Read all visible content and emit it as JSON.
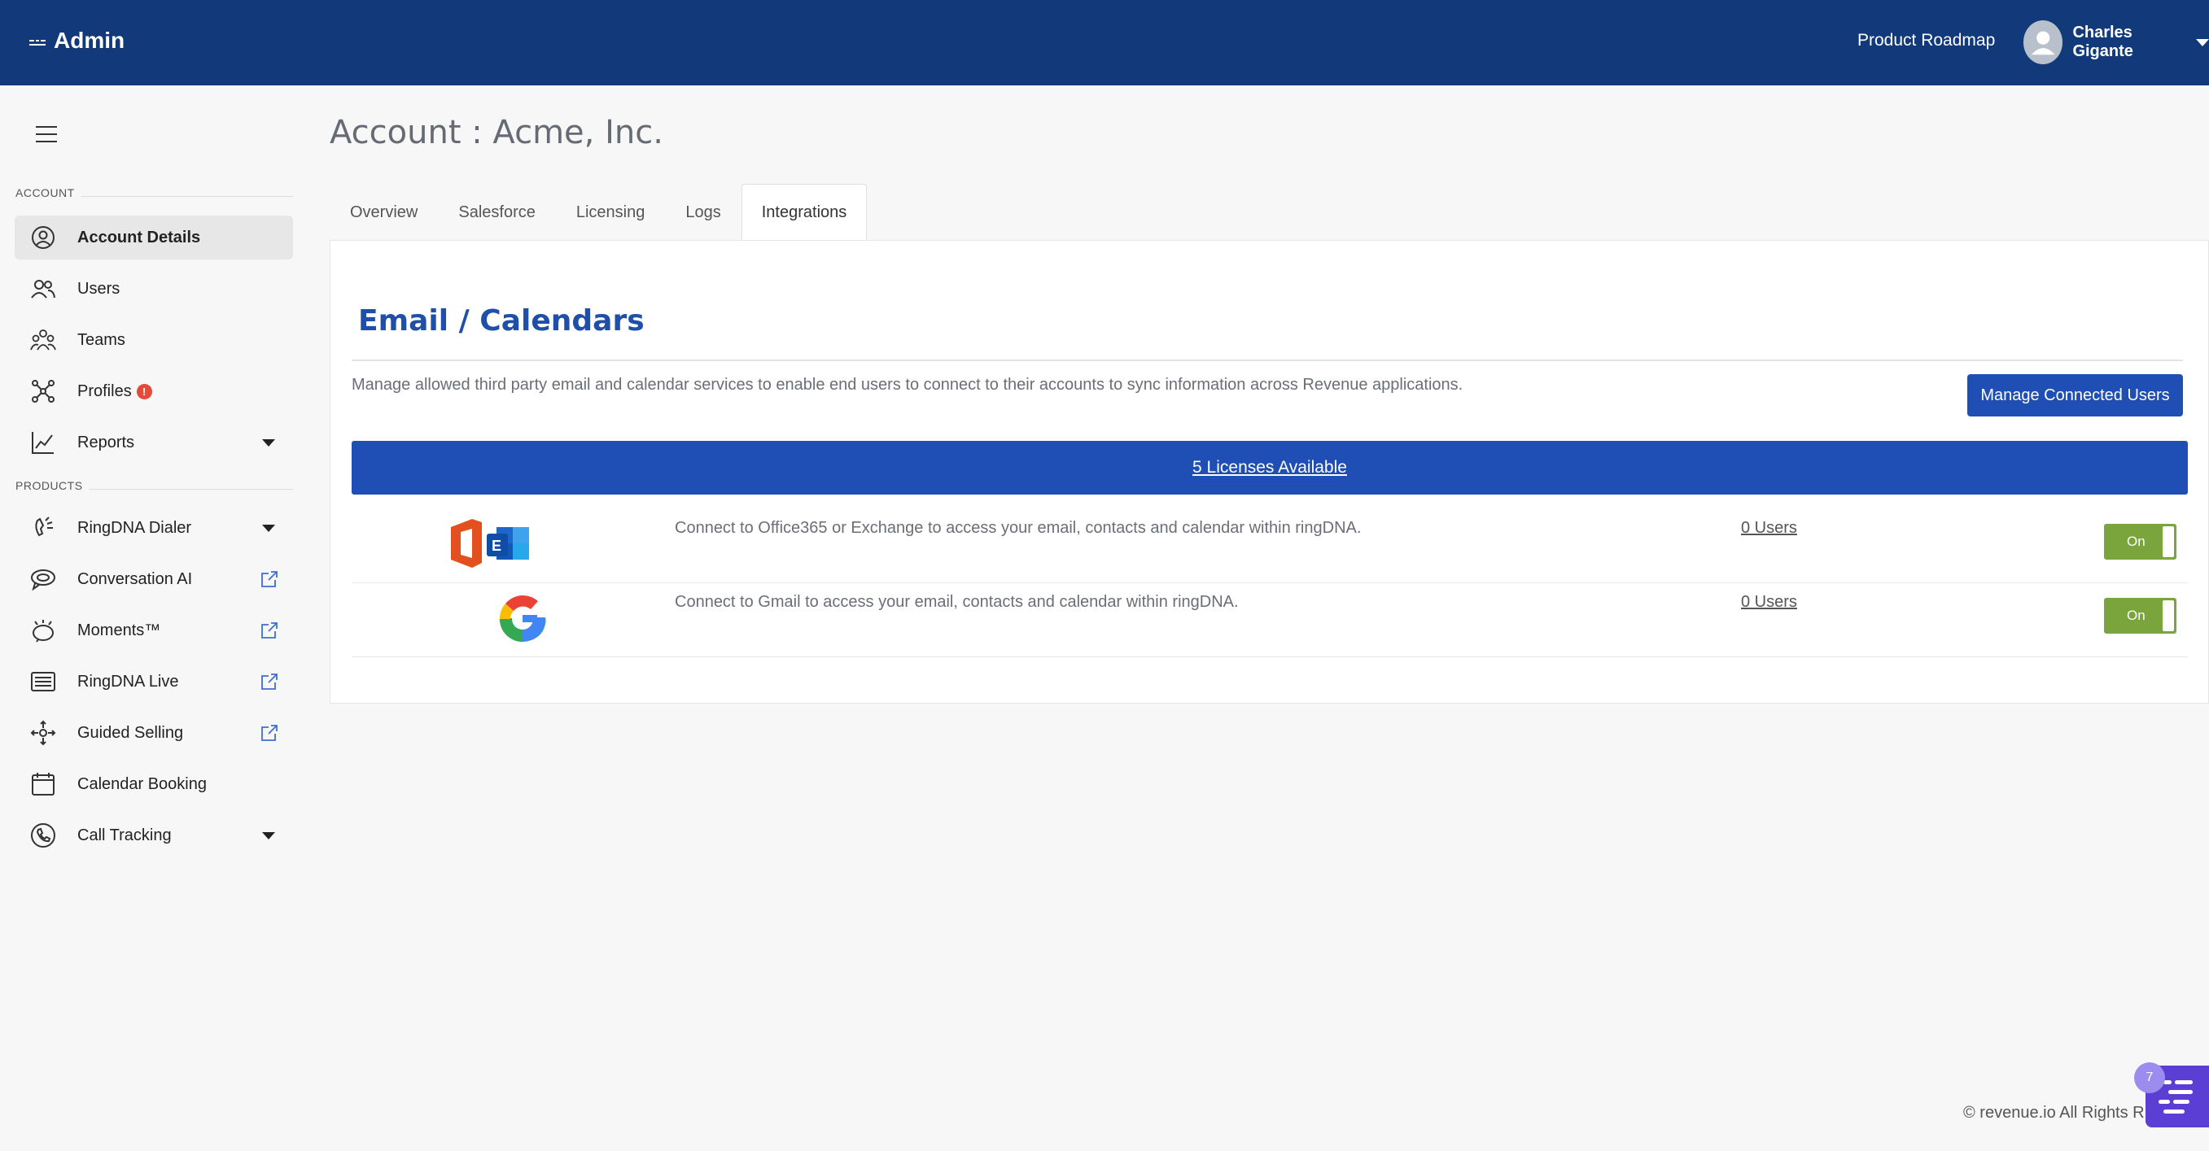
{
  "header": {
    "brand_title": "Admin",
    "brand_mark": "☰",
    "product_roadmap": "Product Roadmap",
    "user_name": "Charles Gigante"
  },
  "sidebar": {
    "sections": {
      "account": "ACCOUNT",
      "products": "PRODUCTS"
    },
    "items": [
      {
        "label": "Account Details",
        "icon": "account-circle-icon",
        "active": true
      },
      {
        "label": "Users",
        "icon": "users-icon"
      },
      {
        "label": "Teams",
        "icon": "teams-icon"
      },
      {
        "label": "Profiles",
        "icon": "profiles-icon",
        "badge": "!"
      },
      {
        "label": "Reports",
        "icon": "reports-chart-icon",
        "caret": true
      },
      {
        "label": "RingDNA Dialer",
        "icon": "dialer-icon",
        "caret": true
      },
      {
        "label": "Conversation AI",
        "icon": "conversation-icon",
        "external": true
      },
      {
        "label": "Moments™",
        "icon": "moments-icon",
        "external": true
      },
      {
        "label": "RingDNA Live",
        "icon": "live-icon",
        "external": true
      },
      {
        "label": "Guided Selling",
        "icon": "guided-selling-icon",
        "external": true
      },
      {
        "label": "Calendar Booking",
        "icon": "calendar-icon"
      },
      {
        "label": "Call Tracking",
        "icon": "call-tracking-icon",
        "caret": true
      }
    ]
  },
  "main": {
    "page_title": "Account : Acme, Inc.",
    "tabs": [
      {
        "label": "Overview"
      },
      {
        "label": "Salesforce"
      },
      {
        "label": "Licensing"
      },
      {
        "label": "Logs"
      },
      {
        "label": "Integrations",
        "active": true
      }
    ],
    "section_title": "Email / Calendars",
    "description": "Manage allowed third party email and calendar services to enable end users to connect to their accounts to sync information across Revenue applications.",
    "manage_button": "Manage Connected Users",
    "licenses_link": "5 Licenses Available",
    "integrations": [
      {
        "logo": "office365-exchange-icon",
        "description": "Connect to Office365 or Exchange to access your email, contacts and calendar within ringDNA.",
        "users": "0 Users",
        "toggle": "On"
      },
      {
        "logo": "google-icon",
        "description": "Connect to Gmail to access your email, contacts and calendar within ringDNA.",
        "users": "0 Users",
        "toggle": "On"
      }
    ]
  },
  "footer": {
    "copyright": "© revenue.io All Rights R"
  },
  "chat": {
    "badge": "7"
  },
  "colors": {
    "header_bg": "#123a7b",
    "primary_blue": "#1f4fb5",
    "toggle_green": "#7aa53d",
    "alert_red": "#e24b3b"
  }
}
